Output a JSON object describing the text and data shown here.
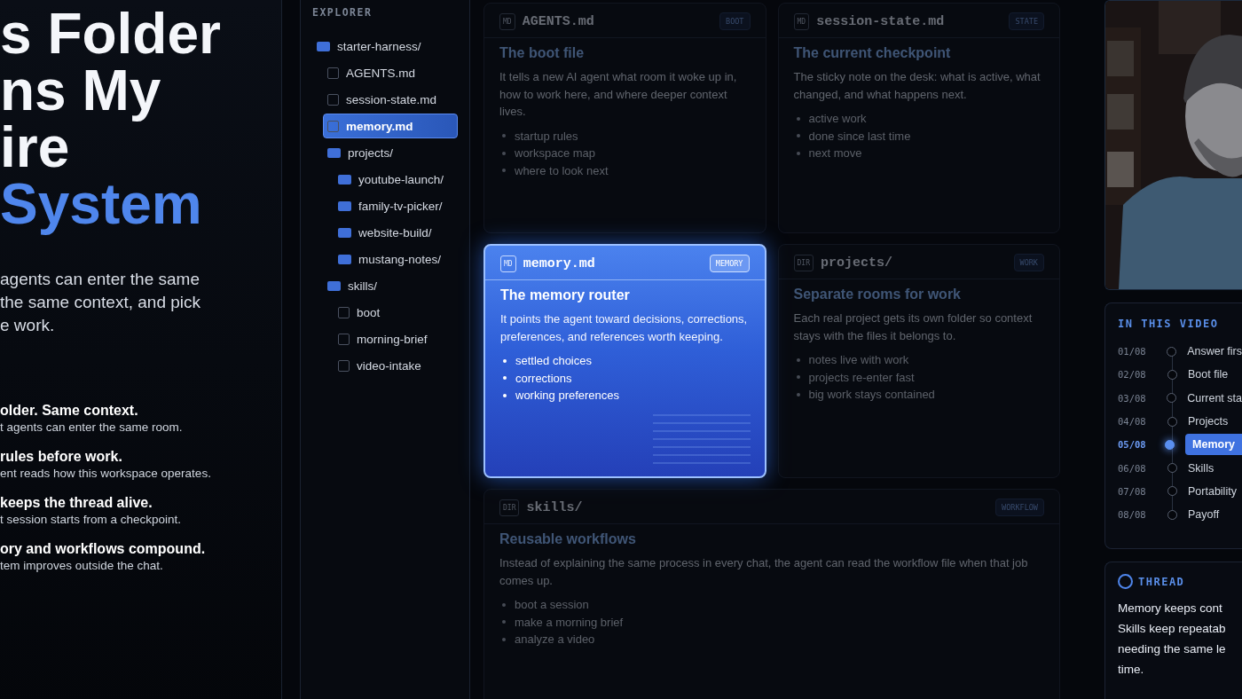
{
  "hero": {
    "title_lines": [
      {
        "text": "s Folder",
        "accent": false
      },
      {
        "text": "ns My",
        "accent": false
      },
      {
        "text": "ire",
        "accent": false
      },
      {
        "text": "System",
        "accent": true
      }
    ],
    "intro_lines": [
      "agents can enter the same",
      "the same context, and pick",
      "e work."
    ],
    "points": [
      {
        "title": "older. Same context.",
        "text": "t agents can enter the same room."
      },
      {
        "title": "rules before work.",
        "text": "ent reads how this workspace operates."
      },
      {
        "title": "keeps the thread alive.",
        "text": "t session starts from a checkpoint."
      },
      {
        "title": "ory and workflows compound.",
        "text": "tem improves outside the chat."
      }
    ]
  },
  "explorer": {
    "title": "EXPLORER",
    "tree": [
      {
        "name": "starter-harness/",
        "kind": "folder",
        "selected": false,
        "children": [
          {
            "name": "AGENTS.md",
            "kind": "file",
            "selected": false
          },
          {
            "name": "session-state.md",
            "kind": "file",
            "selected": false
          },
          {
            "name": "memory.md",
            "kind": "file",
            "selected": true
          },
          {
            "name": "projects/",
            "kind": "folder",
            "selected": false,
            "children": [
              {
                "name": "youtube-launch/",
                "kind": "folder",
                "selected": false
              },
              {
                "name": "family-tv-picker/",
                "kind": "folder",
                "selected": false
              },
              {
                "name": "website-build/",
                "kind": "folder",
                "selected": false
              },
              {
                "name": "mustang-notes/",
                "kind": "folder",
                "selected": false
              }
            ]
          },
          {
            "name": "skills/",
            "kind": "folder",
            "selected": false,
            "children": [
              {
                "name": "boot",
                "kind": "file",
                "selected": false
              },
              {
                "name": "morning-brief",
                "kind": "file",
                "selected": false
              },
              {
                "name": "video-intake",
                "kind": "file",
                "selected": false
              }
            ]
          }
        ]
      }
    ]
  },
  "cards": [
    {
      "type": "MD",
      "name": "AGENTS.md",
      "tag": "BOOT",
      "heading": "The boot file",
      "body": "It tells a new AI agent what room it woke up in, how to work here, and where deeper context lives.",
      "bullets": [
        "startup rules",
        "workspace map",
        "where to look next"
      ],
      "selected": false,
      "wide": false
    },
    {
      "type": "MD",
      "name": "session-state.md",
      "tag": "STATE",
      "heading": "The current checkpoint",
      "body": "The sticky note on the desk: what is active, what changed, and what happens next.",
      "bullets": [
        "active work",
        "done since last time",
        "next move"
      ],
      "selected": false,
      "wide": false
    },
    {
      "type": "MD",
      "name": "memory.md",
      "tag": "MEMORY",
      "heading": "The memory router",
      "body": "It points the agent toward decisions, corrections, preferences, and references worth keeping.",
      "bullets": [
        "settled choices",
        "corrections",
        "working preferences"
      ],
      "selected": true,
      "wide": false
    },
    {
      "type": "DIR",
      "name": "projects/",
      "tag": "WORK",
      "heading": "Separate rooms for work",
      "body": "Each real project gets its own folder so context stays with the files it belongs to.",
      "bullets": [
        "notes live with work",
        "projects re-enter fast",
        "big work stays contained"
      ],
      "selected": false,
      "wide": false
    },
    {
      "type": "DIR",
      "name": "skills/",
      "tag": "WORKFLOW",
      "heading": "Reusable workflows",
      "body": "Instead of explaining the same process in every chat, the agent can read the workflow file when that job comes up.",
      "bullets": [
        "boot a session",
        "make a morning brief",
        "analyze a video"
      ],
      "selected": false,
      "wide": true
    }
  ],
  "outline": {
    "title": "IN THIS VIDEO",
    "items": [
      {
        "number": "01/08",
        "label": "Answer firs",
        "selected": false
      },
      {
        "number": "02/08",
        "label": "Boot file",
        "selected": false
      },
      {
        "number": "03/08",
        "label": "Current sta",
        "selected": false
      },
      {
        "number": "04/08",
        "label": "Projects",
        "selected": false
      },
      {
        "number": "05/08",
        "label": "Memory",
        "selected": true
      },
      {
        "number": "06/08",
        "label": "Skills",
        "selected": false
      },
      {
        "number": "07/08",
        "label": "Portability",
        "selected": false
      },
      {
        "number": "08/08",
        "label": "Payoff",
        "selected": false
      }
    ]
  },
  "thread": {
    "title": "THREAD",
    "lines": [
      "Memory keeps cont",
      "Skills keep repeatab",
      "needing the same le",
      "time."
    ]
  }
}
